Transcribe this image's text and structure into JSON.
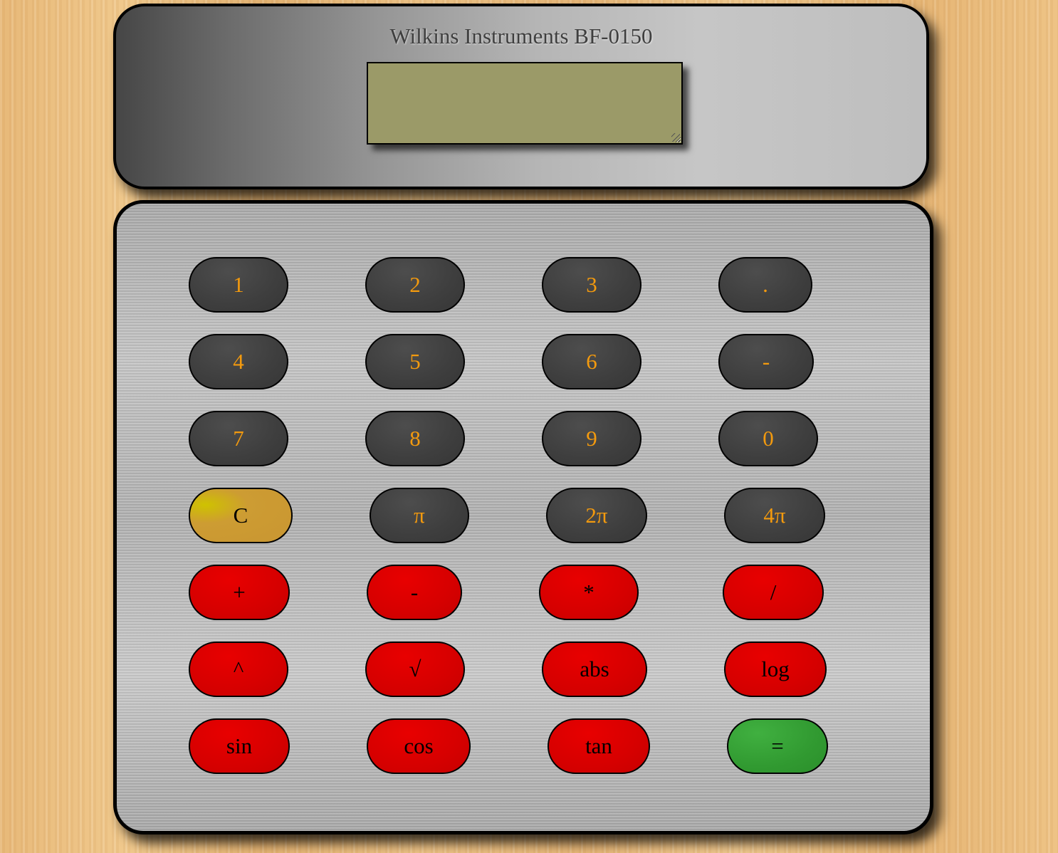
{
  "calculator": {
    "model_name": "Wilkins Instruments BF-0150",
    "display_value": ""
  },
  "colors": {
    "display_screen": "#9b9a68",
    "digit_key": "#3e3e3e",
    "digit_text": "#f39a0e",
    "function_key": "#d60000",
    "clear_key": "#cd9c33",
    "equals_key": "#319a31"
  },
  "keys": {
    "one": "1",
    "two": "2",
    "three": "3",
    "decimal": ".",
    "four": "4",
    "five": "5",
    "six": "6",
    "negative": "-",
    "seven": "7",
    "eight": "8",
    "nine": "9",
    "zero": "0",
    "clear": "C",
    "pi": "π",
    "two_pi": "2π",
    "four_pi": "4π",
    "add": "+",
    "subtract": "-",
    "multiply": "*",
    "divide": "/",
    "power": "^",
    "sqrt": "√",
    "abs": "abs",
    "log": "log",
    "sin": "sin",
    "cos": "cos",
    "tan": "tan",
    "equals": "="
  }
}
